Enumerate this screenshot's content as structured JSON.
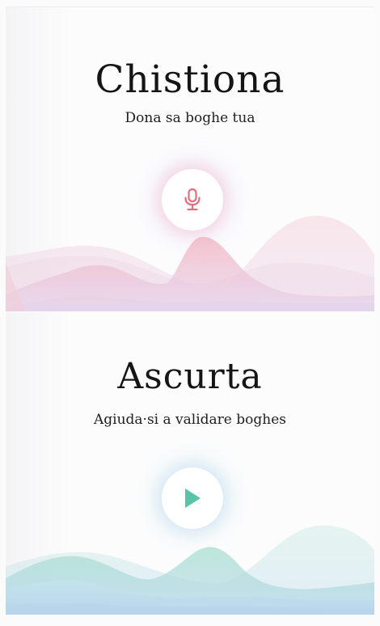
{
  "speak_card": {
    "title": "Chistiona",
    "subtitle": "Dona sa boghe tua",
    "icon": "microphone-icon",
    "accent_color": "#e36f7e"
  },
  "listen_card": {
    "title": "Ascurta",
    "subtitle": "Agiuda·si a validare boghes",
    "icon": "play-icon",
    "accent_color": "#59c3a8"
  }
}
